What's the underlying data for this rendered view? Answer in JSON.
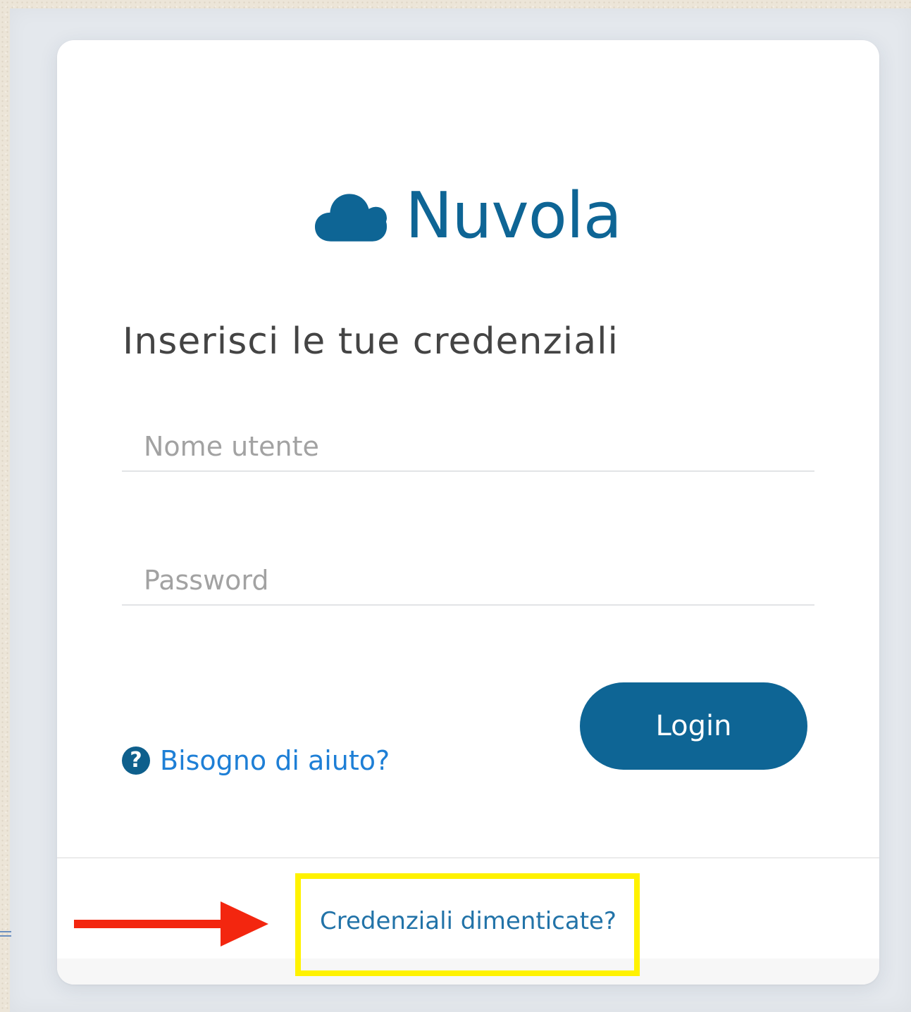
{
  "brand": {
    "name": "Nuvola",
    "icon": "cloud-icon",
    "color": "#0e6595"
  },
  "form": {
    "heading": "Inserisci le tue credenziali",
    "username_placeholder": "Nome utente",
    "password_placeholder": "Password",
    "help_icon": "question-circle-icon",
    "help_label": "Bisogno di aiuto?",
    "login_label": "Login"
  },
  "footer": {
    "forgot_label": "Credenziali dimenticate?"
  },
  "annotations": {
    "highlight_color": "#fff200",
    "arrow_color": "#f3260f"
  }
}
